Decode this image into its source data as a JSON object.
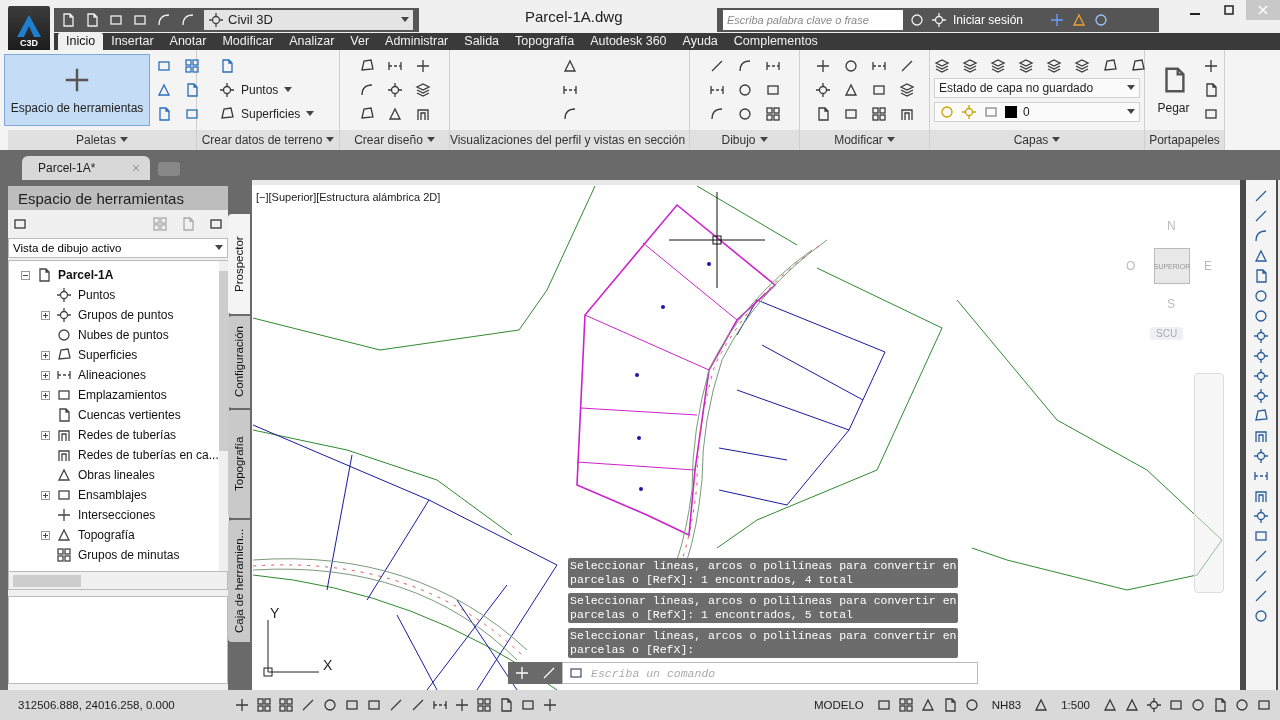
{
  "app": {
    "badge": "C3D",
    "workspace": "Civil 3D",
    "document_title": "Parcel-1A.dwg",
    "search": {
      "placeholder": "Escriba palabra clave o frase"
    },
    "sign_in": "Iniciar sesión"
  },
  "menu_tabs": [
    {
      "label": "Inicio",
      "selected": true
    },
    {
      "label": "Insertar",
      "selected": false
    },
    {
      "label": "Anotar",
      "selected": false
    },
    {
      "label": "Modificar",
      "selected": false
    },
    {
      "label": "Analizar",
      "selected": false
    },
    {
      "label": "Ver",
      "selected": false
    },
    {
      "label": "Administrar",
      "selected": false
    },
    {
      "label": "Salida",
      "selected": false
    },
    {
      "label": "Topografía",
      "selected": false
    },
    {
      "label": "Autodesk 360",
      "selected": false
    },
    {
      "label": "Ayuda",
      "selected": false
    },
    {
      "label": "Complementos",
      "selected": false
    }
  ],
  "ribbon": [
    {
      "kind": "palettes",
      "title": "Paletas",
      "button": {
        "label": "Espacio de herramientas",
        "active": true
      }
    },
    {
      "kind": "terrain",
      "title": "Crear datos de terreno",
      "buttons": [
        "Puntos",
        "Superficies"
      ]
    },
    {
      "kind": "design",
      "title": "Crear diseño"
    },
    {
      "kind": "profile",
      "title": "Visualizaciones del perfil y vistas en sección"
    },
    {
      "kind": "draw",
      "title": "Dibujo"
    },
    {
      "kind": "modify",
      "title": "Modificar"
    },
    {
      "kind": "layers",
      "title": "Capas",
      "state_dropdown": "Estado de capa no guardado",
      "layer_dropdown": "0"
    },
    {
      "kind": "clipboard",
      "title": "Portapapeles",
      "button": "Pegar"
    }
  ],
  "file_tabs": [
    {
      "label": "Parcel-1A*",
      "selected": true
    }
  ],
  "tool_palette": {
    "title": "Espacio de herramientas",
    "view_select": "Vista de dibujo activo",
    "tree": {
      "label": "Parcel-1A",
      "expanded": true,
      "children": [
        {
          "label": "Puntos",
          "expandable": false
        },
        {
          "label": "Grupos de puntos",
          "expandable": true
        },
        {
          "label": "Nubes de puntos",
          "expandable": false
        },
        {
          "label": "Superficies",
          "expandable": true
        },
        {
          "label": "Alineaciones",
          "expandable": true
        },
        {
          "label": "Emplazamientos",
          "expandable": true
        },
        {
          "label": "Cuencas vertientes",
          "expandable": false
        },
        {
          "label": "Redes de tuberías",
          "expandable": true
        },
        {
          "label": "Redes de tuberías en ca...",
          "expandable": false
        },
        {
          "label": "Obras lineales",
          "expandable": false
        },
        {
          "label": "Ensamblajes",
          "expandable": true
        },
        {
          "label": "Intersecciones",
          "expandable": false
        },
        {
          "label": "Topografía",
          "expandable": true
        },
        {
          "label": "Grupos de minutas",
          "expandable": false
        }
      ]
    },
    "side_tabs": [
      {
        "label": "Prospector",
        "selected": true
      },
      {
        "label": "Configuración",
        "selected": false
      },
      {
        "label": "Topografía",
        "selected": false
      },
      {
        "label": "Caja de herramien...",
        "selected": false
      }
    ]
  },
  "viewport": {
    "label": "[−][Superior][Estructura alámbrica 2D]",
    "viewcube": {
      "face": "SUPERIOR",
      "north": "N",
      "south": "S",
      "east": "E",
      "west": "O",
      "ucs": "SCU"
    },
    "ucs_axes": {
      "x": "X",
      "y": "Y"
    },
    "command_history": [
      {
        "lines": [
          "Seleccionar líneas, arcos o polilíneas para convertir en",
          "parcelas o [RefX]: 1 encontrados, 4 total"
        ]
      },
      {
        "lines": [
          "Seleccionar líneas, arcos o polilíneas para convertir en",
          "parcelas o [RefX]: 1 encontrados, 5 total"
        ]
      },
      {
        "lines": [
          "Seleccionar líneas, arcos o polilíneas para convertir en",
          "parcelas o [RefX]:"
        ]
      }
    ],
    "command_line": {
      "placeholder": "Escriba un comando"
    }
  },
  "status_bar": {
    "coordinates": "312506.888, 24016.258, 0.000",
    "space": "MODELO",
    "coordinate_system": "NH83",
    "scale": "1:500"
  }
}
